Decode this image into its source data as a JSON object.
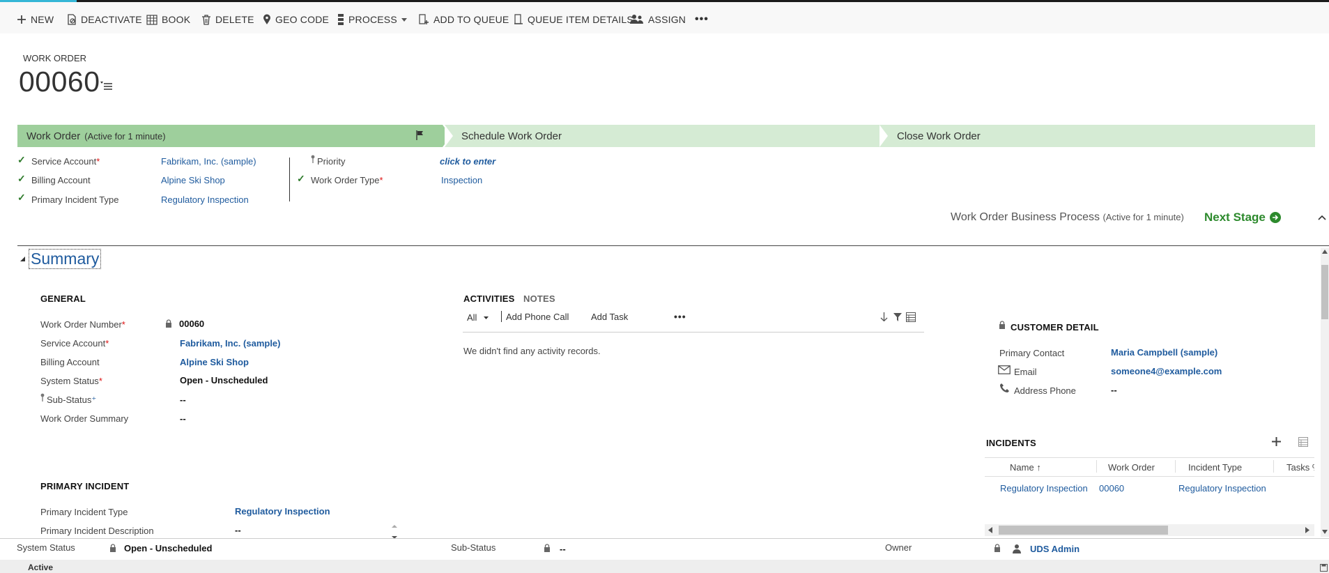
{
  "toolbar": {
    "new": "NEW",
    "deactivate": "DEACTIVATE",
    "book": "BOOK",
    "delete": "DELETE",
    "geocode": "GEO CODE",
    "process": "PROCESS",
    "add_to_queue": "ADD TO QUEUE",
    "queue_item_details": "QUEUE ITEM DETAILS",
    "assign": "ASSIGN",
    "more": "•••"
  },
  "header": {
    "entity_label": "WORK ORDER",
    "number": "00060"
  },
  "process": {
    "stages": [
      {
        "label": "Work Order",
        "status": "(Active for 1 minute)"
      },
      {
        "label": "Schedule Work Order"
      },
      {
        "label": "Close Work Order"
      }
    ],
    "fields_left": [
      {
        "label": "Service Account",
        "value": "Fabrikam, Inc. (sample)"
      },
      {
        "label": "Billing Account",
        "value": "Alpine Ski Shop"
      },
      {
        "label": "Primary Incident Type",
        "value": "Regulatory Inspection"
      }
    ],
    "fields_right": [
      {
        "label": "Priority",
        "value": "click to enter"
      },
      {
        "label": "Work Order Type",
        "value": "Inspection"
      }
    ],
    "footer_title": "Work Order Business Process",
    "footer_status": "(Active for 1 minute)",
    "next_stage": "Next Stage"
  },
  "summary": {
    "title": "Summary",
    "general": {
      "heading": "GENERAL",
      "fields": [
        {
          "label": "Work Order Number",
          "value": "00060"
        },
        {
          "label": "Service Account",
          "value": "Fabrikam, Inc. (sample)"
        },
        {
          "label": "Billing Account",
          "value": "Alpine Ski Shop"
        },
        {
          "label": "System Status",
          "value": "Open - Unscheduled"
        },
        {
          "label": "Sub-Status",
          "value": "--"
        },
        {
          "label": "Work Order Summary",
          "value": "--"
        }
      ]
    },
    "primary_incident": {
      "heading": "PRIMARY INCIDENT",
      "fields": [
        {
          "label": "Primary Incident Type",
          "value": "Regulatory Inspection"
        },
        {
          "label": "Primary Incident Description",
          "value": "--"
        }
      ]
    },
    "activities": {
      "tab_activities": "ACTIVITIES",
      "tab_notes": "NOTES",
      "filter": "All",
      "add_phone_call": "Add Phone Call",
      "add_task": "Add Task",
      "more": "•••",
      "empty": "We didn't find any activity records."
    },
    "customer": {
      "heading": "CUSTOMER DETAIL",
      "fields": [
        {
          "label": "Primary Contact",
          "value": "Maria Campbell (sample)"
        },
        {
          "label": "Email",
          "value": "someone4@example.com"
        },
        {
          "label": "Address Phone",
          "value": "--"
        }
      ]
    },
    "incidents": {
      "heading": "INCIDENTS",
      "columns": [
        "Name",
        "Work Order",
        "Incident Type",
        "Tasks %"
      ],
      "rows": [
        {
          "name": "Regulatory Inspection",
          "work_order": "00060",
          "incident_type": "Regulatory Inspection"
        }
      ]
    }
  },
  "footer": {
    "system_status_label": "System Status",
    "system_status_value": "Open - Unscheduled",
    "sub_status_label": "Sub-Status",
    "sub_status_value": "--",
    "owner_label": "Owner",
    "owner_value": "UDS Admin",
    "state": "Active"
  },
  "colors": {
    "accent": "#35b6d6",
    "stage_active": "#9ecf9c",
    "stage_inactive": "#d5ebd4",
    "link": "#1f5b9e",
    "next_stage": "#2d8a2d"
  }
}
